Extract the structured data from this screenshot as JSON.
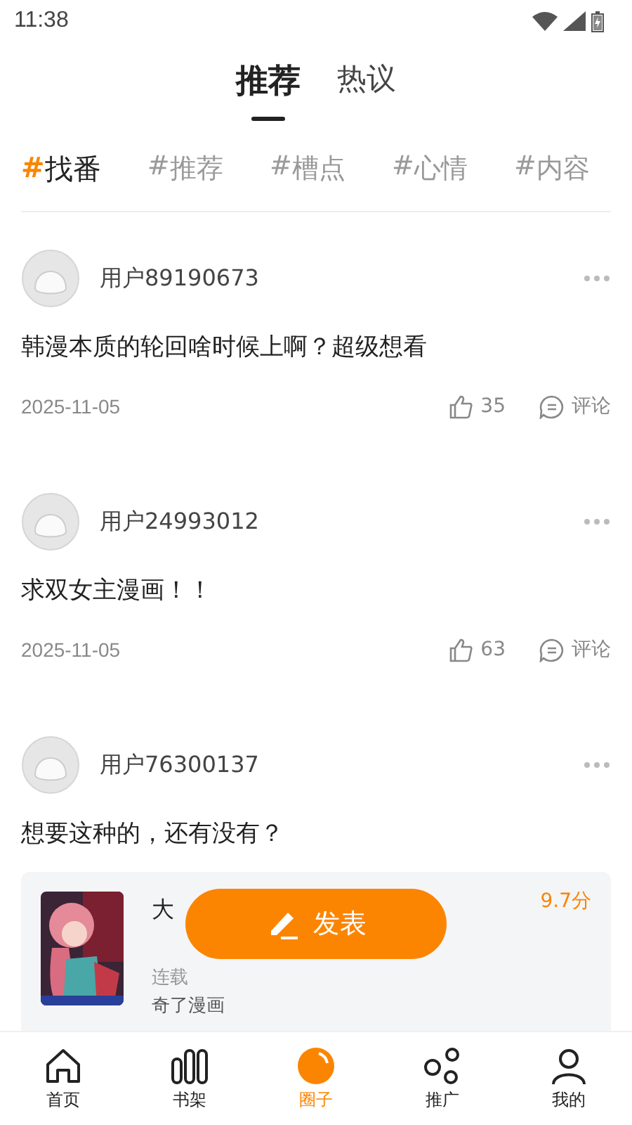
{
  "status_bar": {
    "time": "11:38"
  },
  "tabs": [
    {
      "label": "推荐",
      "selected": true
    },
    {
      "label": "热议",
      "selected": false
    }
  ],
  "topics": [
    {
      "hash": "#",
      "label": "找番",
      "selected": true
    },
    {
      "hash": "#",
      "label": "推荐",
      "selected": false
    },
    {
      "hash": "#",
      "label": "槽点",
      "selected": false
    },
    {
      "hash": "#",
      "label": "心情",
      "selected": false
    },
    {
      "hash": "#",
      "label": "内容",
      "selected": false
    }
  ],
  "posts": [
    {
      "user": "用户89190673",
      "text": "韩漫本质的轮回啥时候上啊？超级想看",
      "date": "2025-11-05",
      "likes": "35",
      "comment": "评论"
    },
    {
      "user": "用户24993012",
      "text": "求双女主漫画！！",
      "date": "2025-11-05",
      "likes": "63",
      "comment": "评论"
    },
    {
      "user": "用户76300137",
      "text": "想要这种的，还有没有？",
      "book": {
        "kind": "picture",
        "title": "大",
        "subtitle": "连载",
        "score": "9.7分",
        "source": "奇了漫画"
      }
    }
  ],
  "publish_button": "发表",
  "nav": [
    {
      "label": "首页",
      "selected": false
    },
    {
      "label": "书架",
      "selected": false
    },
    {
      "label": "圈子",
      "selected": true
    },
    {
      "label": "推广",
      "selected": false
    },
    {
      "label": "我的",
      "selected": false
    }
  ]
}
